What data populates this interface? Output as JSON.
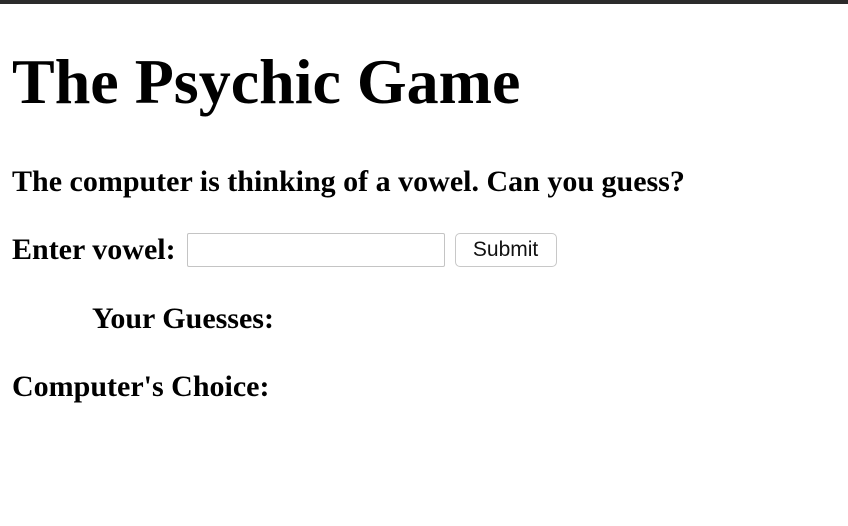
{
  "page": {
    "title": "The Psychic Game",
    "prompt": "The computer is thinking of a vowel. Can you guess?"
  },
  "form": {
    "label": "Enter vowel:",
    "input_value": "",
    "submit_label": "Submit"
  },
  "results": {
    "guesses_label": "Your Guesses:",
    "choice_label": "Computer's Choice:"
  }
}
